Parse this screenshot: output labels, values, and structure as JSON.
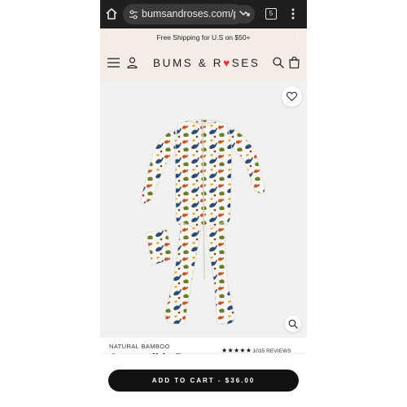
{
  "browser": {
    "url": "bumsandroses.com/p",
    "tab_count": "5"
  },
  "announcement": {
    "text": "Free Shipping for U.S on $50+"
  },
  "header": {
    "logo_left": "BUMS & R",
    "logo_heart": "♥",
    "logo_right": "SES"
  },
  "product": {
    "collection": "NATURAL BAMBOO",
    "stars": "★★★★★",
    "reviews": "1035 REVIEWS",
    "title_partial": "Convertible Romper",
    "image_alt": "Dinosaur print bamboo zip romper"
  },
  "cart": {
    "label": "ADD TO CART - $36.00"
  },
  "colors": {
    "browser_bar": "#1f1f1f",
    "header_bg": "#f3ede6",
    "heart_accent": "#e0393f",
    "button": "#111111"
  },
  "icons": [
    "home-icon",
    "site-settings-icon",
    "extension-icon",
    "tabs-icon",
    "more-menu-icon",
    "hamburger-icon",
    "account-icon",
    "search-icon",
    "bag-icon",
    "wishlist-heart-icon",
    "zoom-icon"
  ]
}
